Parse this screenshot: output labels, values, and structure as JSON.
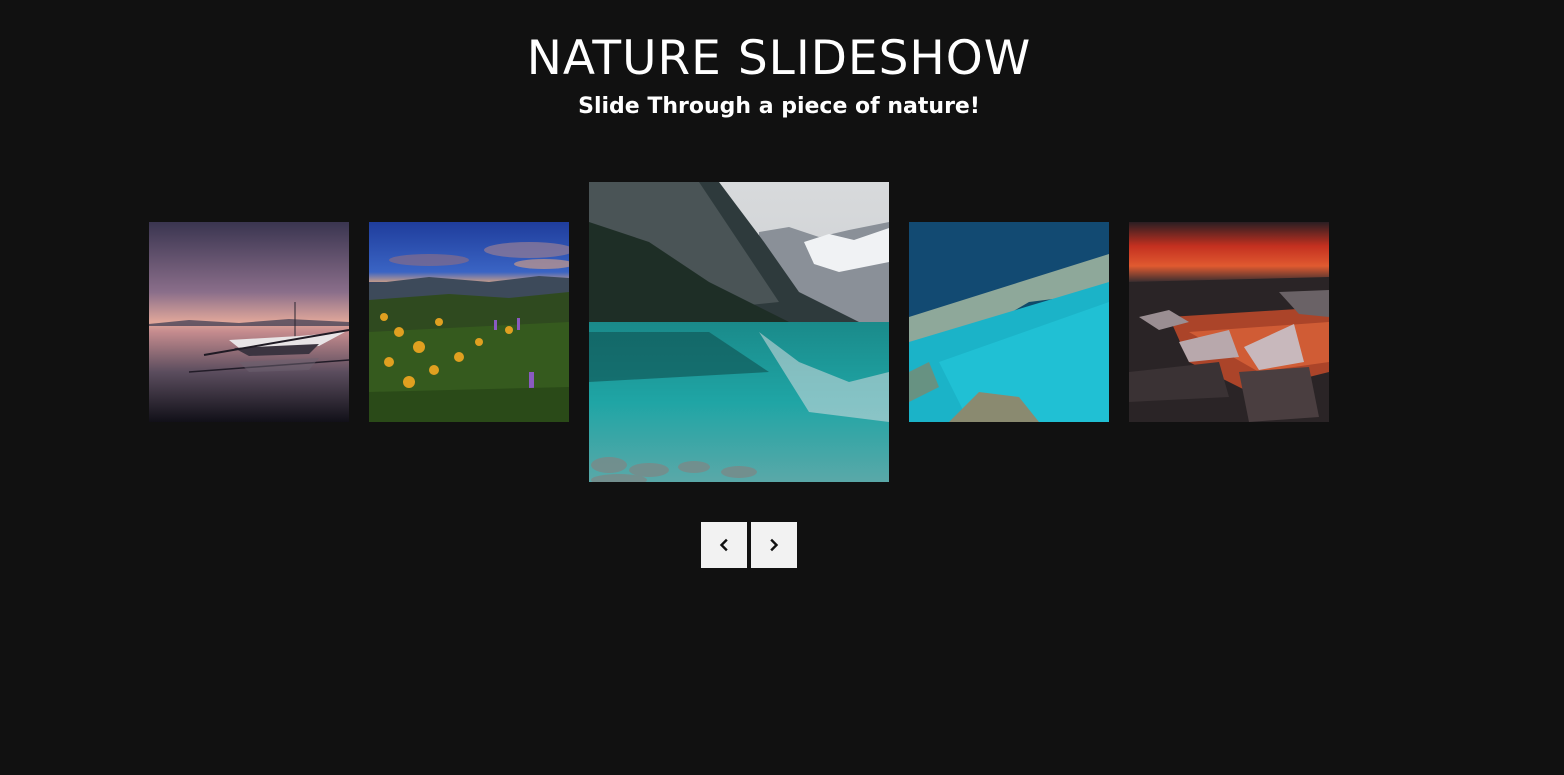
{
  "header": {
    "title": "NATURE SLIDESHOW",
    "subtitle": "Slide Through a piece of nature!"
  },
  "slides": [
    {
      "name": "slide-boat-sunset",
      "active": false
    },
    {
      "name": "slide-flower-meadow",
      "active": false
    },
    {
      "name": "slide-mountain-lake",
      "active": true
    },
    {
      "name": "slide-aerial-reef",
      "active": false
    },
    {
      "name": "slide-ice-lagoon-sunset",
      "active": false
    }
  ],
  "controls": {
    "prev_icon": "chevron-left-icon",
    "next_icon": "chevron-right-icon"
  },
  "colors": {
    "background": "#111111",
    "text": "#ffffff",
    "button_bg": "#f2f2f2",
    "button_icon": "#111111"
  }
}
